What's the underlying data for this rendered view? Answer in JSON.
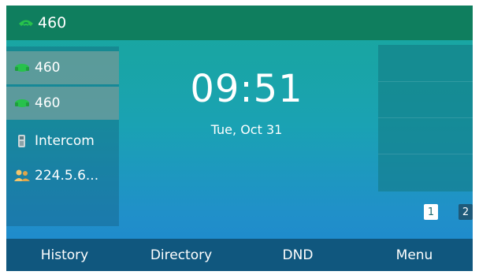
{
  "status_bar": {
    "account": "460",
    "icon": "phone-registered-icon"
  },
  "line_keys": [
    {
      "label": "460",
      "icon": "line-registered-icon",
      "selected": true
    },
    {
      "label": "460",
      "icon": "line-registered-icon",
      "selected": true
    },
    {
      "label": "Intercom",
      "icon": "intercom-icon",
      "selected": false
    },
    {
      "label": "224.5.6...",
      "icon": "multicast-group-icon",
      "selected": false
    }
  ],
  "clock": {
    "time": "09:51",
    "date": "Tue, Oct 31"
  },
  "page_indicator": {
    "pages": [
      "1",
      "2"
    ],
    "current": "1"
  },
  "softkeys": [
    "History",
    "Directory",
    "DND",
    "Menu"
  ],
  "colors": {
    "status_bar": "#0f7e5e",
    "softkey_bar": "#10577e",
    "registered_green": "#27c24c"
  }
}
